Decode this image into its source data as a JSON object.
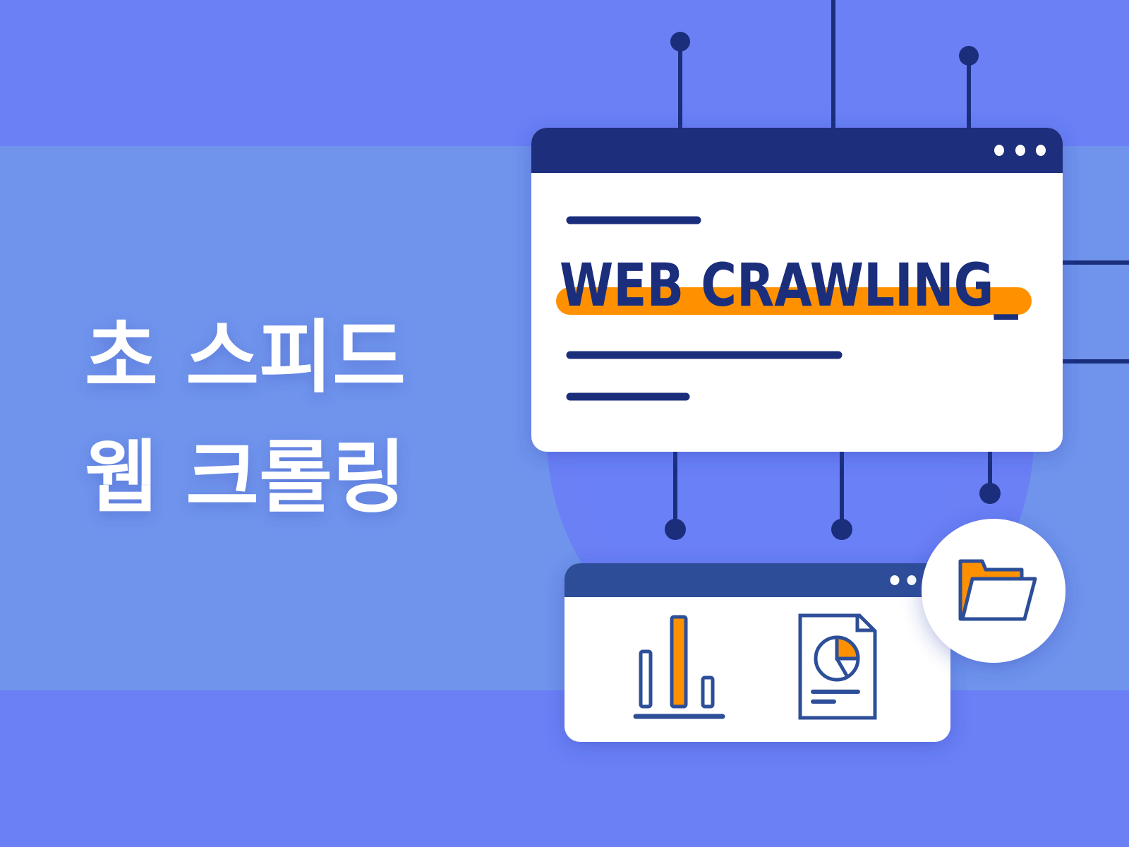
{
  "headline": {
    "line1": "초 스피드",
    "line2": "웹 크롤링"
  },
  "browser_window": {
    "title_text": "WEB CRAWLING_",
    "window_controls": [
      "dot",
      "dot",
      "dot"
    ]
  },
  "result_window": {
    "window_controls": [
      "dot",
      "dot"
    ],
    "icons": [
      "bar-chart-icon",
      "pie-chart-document-icon"
    ]
  },
  "badge": {
    "icon": "folder-open-icon"
  },
  "colors": {
    "background": "#6b80f5",
    "band": "#7094ec",
    "navy": "#1a2e7c",
    "header_secondary": "#2d4e98",
    "accent_orange": "#ff9100",
    "white": "#ffffff"
  }
}
